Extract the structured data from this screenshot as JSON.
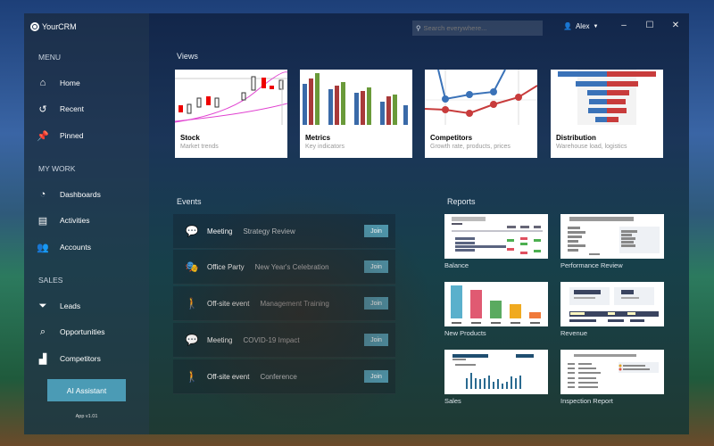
{
  "app": {
    "title": "YourCRM",
    "version": "App v1.01"
  },
  "header": {
    "search_placeholder": "Search everywhere...",
    "user": "Alex"
  },
  "sidebar": {
    "sections": [
      {
        "title": "MENU",
        "items": [
          {
            "label": "Home",
            "icon": "home-icon"
          },
          {
            "label": "Recent",
            "icon": "history-icon"
          },
          {
            "label": "Pinned",
            "icon": "pin-icon"
          }
        ]
      },
      {
        "title": "MY WORK",
        "items": [
          {
            "label": "Dashboards",
            "icon": "dashboard-icon"
          },
          {
            "label": "Activities",
            "icon": "activities-icon"
          },
          {
            "label": "Accounts",
            "icon": "accounts-icon"
          }
        ]
      },
      {
        "title": "SALES",
        "items": [
          {
            "label": "Leads",
            "icon": "funnel-icon"
          },
          {
            "label": "Opportunities",
            "icon": "opportunities-icon"
          },
          {
            "label": "Competitors",
            "icon": "competitors-icon"
          }
        ]
      }
    ],
    "ai_button": "AI Assistant"
  },
  "views": {
    "title": "Views",
    "cards": [
      {
        "title": "Stock",
        "subtitle": "Market trends"
      },
      {
        "title": "Metrics",
        "subtitle": "Key indicators"
      },
      {
        "title": "Competitors",
        "subtitle": "Growth rate, products, prices"
      },
      {
        "title": "Distribution",
        "subtitle": "Warehouse load, logistics"
      }
    ]
  },
  "events": {
    "title": "Events",
    "join_label": "Join",
    "items": [
      {
        "type": "Meeting",
        "name": "Strategy Review",
        "icon": "meeting-icon"
      },
      {
        "type": "Office Party",
        "name": "New Year's Celebration",
        "icon": "party-mask-icon"
      },
      {
        "type": "Off-site event",
        "name": "Management Training",
        "icon": "walking-icon"
      },
      {
        "type": "Meeting",
        "name": "COVID-19 Impact",
        "icon": "meeting-icon"
      },
      {
        "type": "Off-site event",
        "name": "Conference",
        "icon": "walking-icon"
      }
    ]
  },
  "reports": {
    "title": "Reports",
    "items": [
      "Balance",
      "Performance Review",
      "New Products",
      "Revenue",
      "Sales",
      "Inspection Report"
    ]
  },
  "colors": {
    "accent": "#4b9bb5",
    "join": "#4e97ad"
  }
}
